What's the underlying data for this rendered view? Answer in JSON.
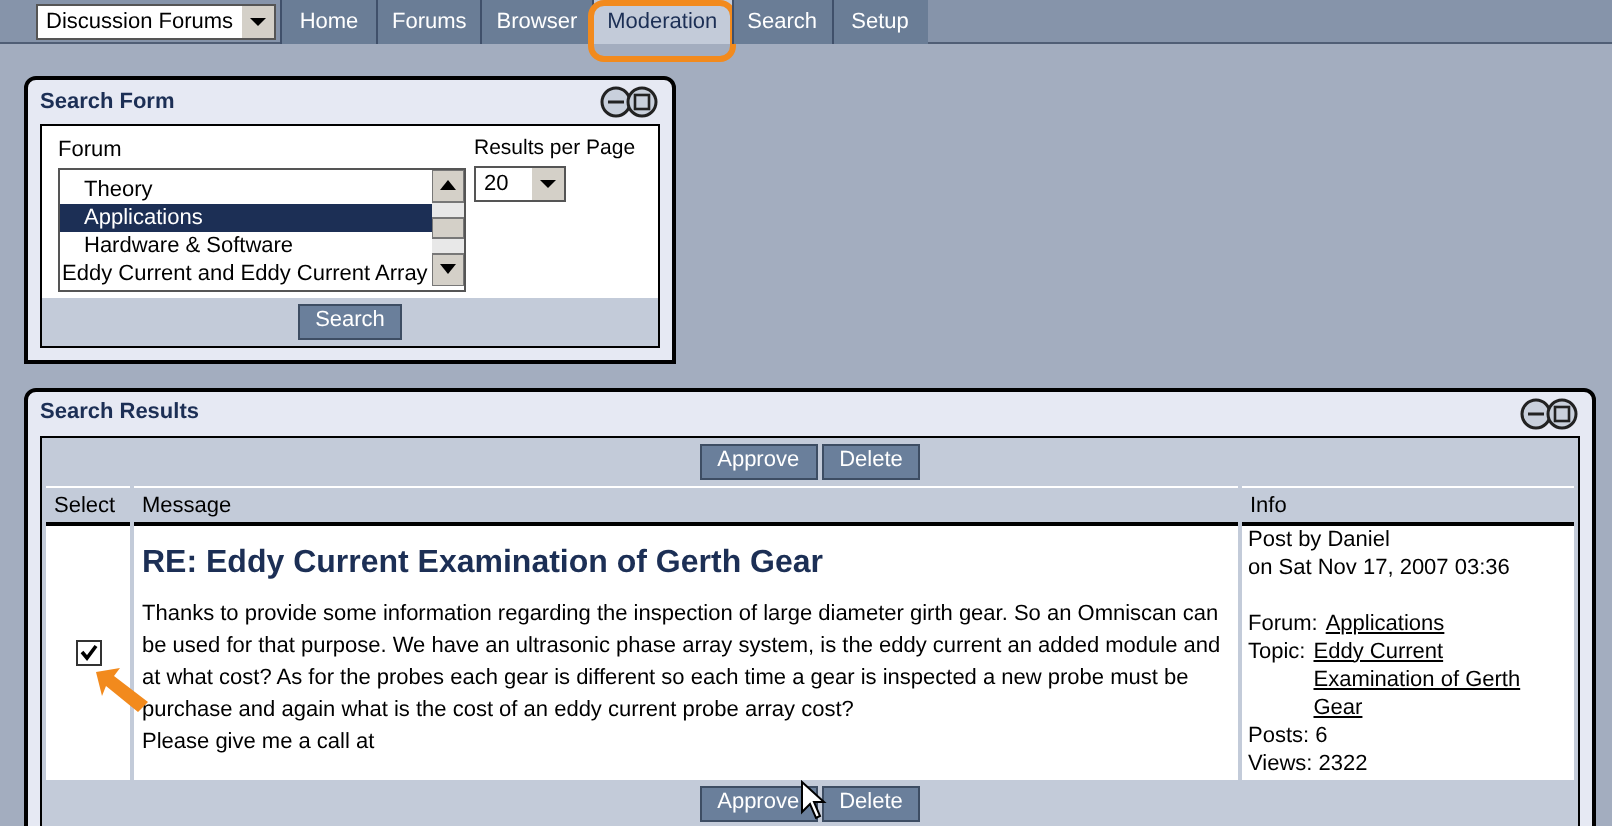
{
  "nav": {
    "forum_select": "Discussion Forums",
    "tabs": [
      {
        "label": "Home",
        "selected": false
      },
      {
        "label": "Forums",
        "selected": false
      },
      {
        "label": "Browser",
        "selected": false
      },
      {
        "label": "Moderation",
        "selected": true
      },
      {
        "label": "Search",
        "selected": false
      },
      {
        "label": "Setup",
        "selected": false
      }
    ]
  },
  "search_form": {
    "title": "Search Form",
    "forum_label": "Forum",
    "forums": [
      {
        "label": "Theory",
        "kind": "sub",
        "selected": false
      },
      {
        "label": "Applications",
        "kind": "sub",
        "selected": true
      },
      {
        "label": "Hardware & Software",
        "kind": "sub",
        "selected": false
      },
      {
        "label": "Eddy Current and Eddy Current Array",
        "kind": "top",
        "selected": false
      }
    ],
    "results_label": "Results per Page",
    "results_value": "20",
    "button": "Search"
  },
  "search_results": {
    "title": "Search Results",
    "buttons_top": [
      "Approve",
      "Delete"
    ],
    "columns": [
      "Select",
      "Message",
      "Info"
    ],
    "rows": [
      {
        "selected": true,
        "subject": "RE: Eddy Current Examination of Gerth Gear",
        "body": "Thanks to provide some information regarding the inspection of large diameter girth gear. So an Omniscan can be used for that purpose. We have an ultrasonic phase array system, is the eddy current an added module and at what cost? As for the probes each gear is different so each time a gear is inspected a new probe must be purchase and again what is the cost of an eddy current probe array cost?",
        "body_2": "Please give me a call at",
        "post_by": "Post by Daniel",
        "date": "on Sat Nov 17, 2007 03:36",
        "forum_label": "Forum:",
        "forum": "Applications",
        "topic_label": "Topic:",
        "topic": "Eddy Current Examination of Gerth Gear",
        "posts": "Posts: 6",
        "views": "Views: 2322"
      }
    ],
    "buttons_bottom": [
      "Approve",
      "Delete"
    ]
  }
}
